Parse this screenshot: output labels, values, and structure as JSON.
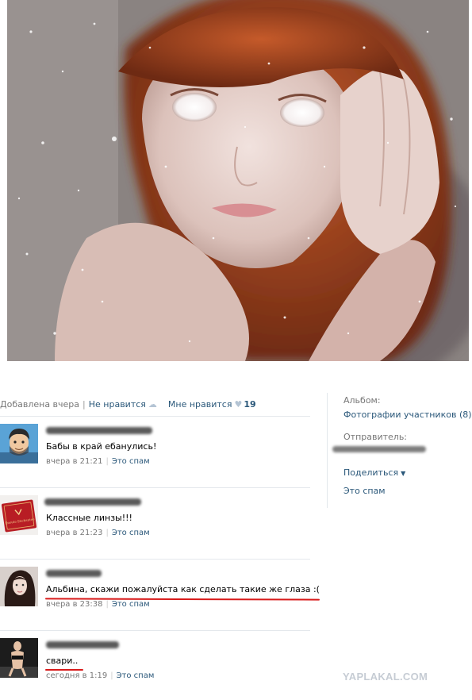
{
  "post": {
    "added": "Добавлена вчера",
    "dislike_label": "Не нравится",
    "like_label": "Мне нравится",
    "like_count": "19"
  },
  "side": {
    "album_label": "Альбом:",
    "album_link": "Фотографии участников (8)",
    "sender_label": "Отправитель:",
    "share_label": "Поделиться",
    "spam_label": "Это спам"
  },
  "comments": [
    {
      "text": "Бабы в край ебанулись!",
      "date": "вчера в 21:21",
      "spam": "Это спам"
    },
    {
      "text": "Классные линзы!!!",
      "date": "вчера в 21:23",
      "spam": "Это спам"
    },
    {
      "text": "Альбина, скажи пожалуйста как сделать такие же глаза :(",
      "date": "вчера в 23:38",
      "spam": "Это спам"
    },
    {
      "text": "свари..",
      "date": "сегодня в 1:19",
      "spam": "Это спам"
    }
  ],
  "avatar_caption": "Enoute Enchantee",
  "watermark": "YAPLAKAL.COM",
  "colors": {
    "link": "#2b587a",
    "meta": "#777777",
    "highlight": "#d81a1a"
  }
}
